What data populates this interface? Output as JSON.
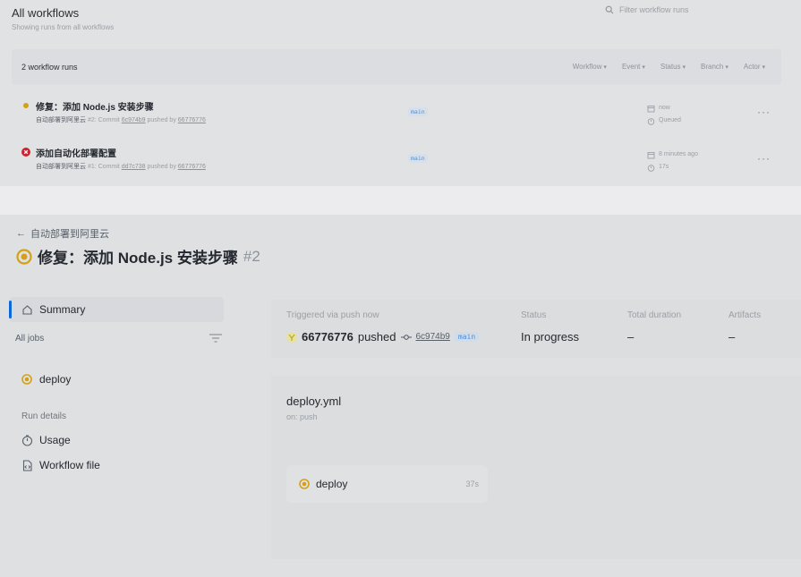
{
  "workflows": {
    "title": "All workflows",
    "subtitle": "Showing runs from all workflows",
    "filter_placeholder": "Filter workflow runs",
    "runs_count": "2 workflow runs",
    "filters": [
      "Workflow",
      "Event",
      "Status",
      "Branch",
      "Actor"
    ],
    "runs": [
      {
        "title": "修复：添加 Node.js 安装步骤",
        "workflow": "自动部署到阿里云",
        "run_label": "#2: Commit",
        "commit": "6c974b9",
        "pushed_by": "pushed by",
        "actor": "66776776",
        "branch": "main",
        "time": "now",
        "duration": "Queued",
        "status": "in_progress"
      },
      {
        "title": "添加自动化部署配置",
        "workflow": "自动部署到阿里云",
        "run_label": "#1: Commit",
        "commit": "dd7c738",
        "pushed_by": "pushed by",
        "actor": "66776776",
        "branch": "main",
        "time": "8 minutes ago",
        "duration": "17s",
        "status": "failed"
      }
    ],
    "more": "···"
  },
  "run": {
    "back_label": "自动部署到阿里云",
    "title": "修复：添加 Node.js 安装步骤",
    "number": "#2",
    "sidebar": {
      "summary": "Summary",
      "all_jobs": "All jobs",
      "job": "deploy",
      "run_details": "Run details",
      "usage": "Usage",
      "workflow_file": "Workflow file"
    },
    "summary": {
      "triggered_label": "Triggered via push now",
      "actor": "66776776",
      "pushed": "pushed",
      "commit": "6c974b9",
      "branch": "main",
      "status_label": "Status",
      "status_value": "In progress",
      "duration_label": "Total duration",
      "duration_value": "–",
      "artifacts_label": "Artifacts",
      "artifacts_value": "–"
    },
    "graph": {
      "file": "deploy.yml",
      "on": "on: push",
      "job_name": "deploy",
      "job_duration": "37s"
    }
  },
  "colors": {
    "in_progress": "#d4a017",
    "failed": "#cf222e",
    "accent": "#0969da",
    "branch_text": "#4a8fd6"
  }
}
